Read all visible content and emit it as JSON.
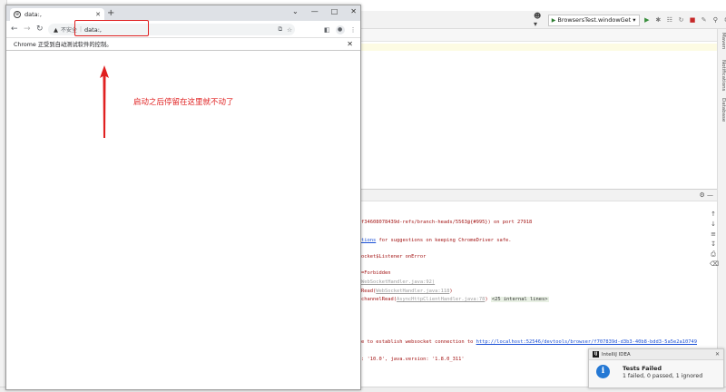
{
  "ide": {
    "run_config": "BrowsersTest.windowGet",
    "side_tabs": [
      "Maven",
      "Notifications",
      "Database"
    ],
    "console_lines": [
      {
        "text": "f34608078439d-refs/branch-heads/5563@{#995}) on port 27918",
        "style": "red"
      },
      {
        "text": "tions",
        "style": "link",
        "rest": " for suggestions on keeping ChromeDriver safe."
      },
      {
        "text": "ocket$Listener onError",
        "style": "red"
      },
      {
        "text": "=Forbidden",
        "style": "red"
      },
      {
        "text": "WebSocketHandler.java:92)",
        "style": "grey"
      },
      {
        "text": "Read(",
        "style": "red",
        "grey": "WebSocketHandler.java:118",
        "end": ")"
      },
      {
        "text": "channelRead(",
        "style": "red",
        "grey": "AsyncHttpClientHandler.java:78",
        "end": ") ",
        "badge": "<25 internal lines>"
      },
      {
        "text": "e to establish websocket connection to ",
        "style": "red",
        "link": "http://localhost:52546/devtools/browser/f707839d-d3b3-40b8-bdd3-5a5e2a10749"
      },
      {
        "text": ": '10.0', java.version: '1.8.0_311'",
        "style": "red"
      }
    ]
  },
  "chrome": {
    "tab_title": "data:,",
    "address": {
      "insecure_label": "不安全",
      "url": "data:,"
    },
    "infobar_text": "Chrome 正受到自动测试软件的控制。"
  },
  "annotation": {
    "text": "启动之后停留在这里就不动了",
    "color": "#e02020"
  },
  "notification": {
    "app": "IntelliJ IDEA",
    "title": "Tests Failed",
    "summary": "1 failed, 0 passed, 1 ignored"
  }
}
